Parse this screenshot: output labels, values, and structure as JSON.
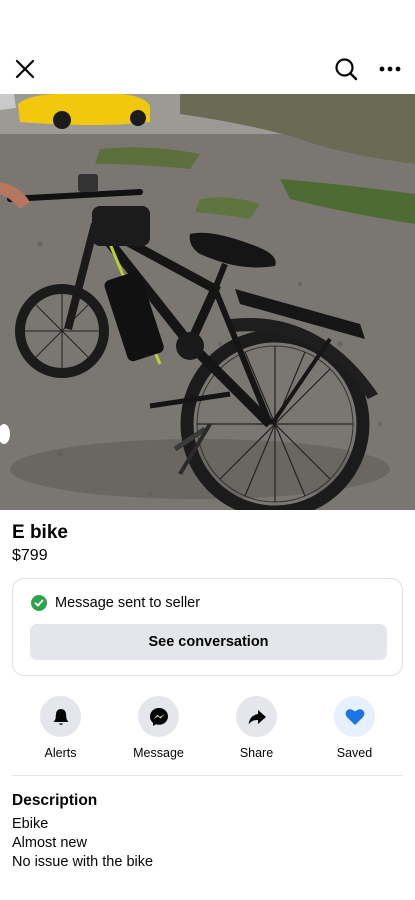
{
  "header": {
    "close_icon": "close-icon",
    "search_icon": "search-icon",
    "more_icon": "more-horizontal-icon"
  },
  "photo": {
    "description_icon": "listing-photo",
    "page_dots": 5,
    "active_dot": 1
  },
  "listing": {
    "title": "E bike",
    "price": "$799"
  },
  "message_card": {
    "status_text": "Message sent to seller",
    "status_icon": "check-circle-icon",
    "status_color": "#31a24c",
    "button_label": "See conversation"
  },
  "actions": [
    {
      "label": "Alerts",
      "icon": "bell-icon"
    },
    {
      "label": "Message",
      "icon": "messenger-icon"
    },
    {
      "label": "Share",
      "icon": "share-arrow-icon"
    },
    {
      "label": "Saved",
      "icon": "heart-icon",
      "accent": "#1b74e4"
    }
  ],
  "description": {
    "heading": "Description",
    "lines": [
      "Ebike",
      "Almost new",
      "No issue with the bike"
    ]
  }
}
